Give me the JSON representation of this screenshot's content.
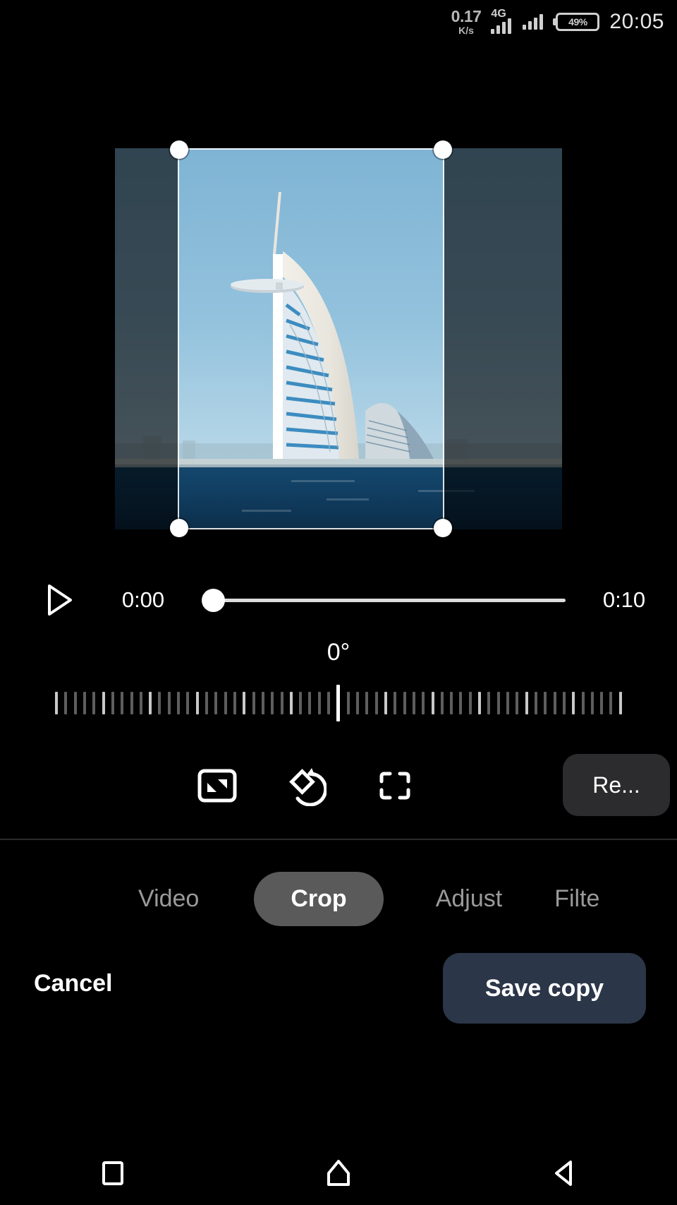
{
  "status_bar": {
    "net_speed_value": "0.17",
    "net_speed_unit": "K/s",
    "network_type": "4G",
    "battery_percent": "49%",
    "clock": "20:05"
  },
  "preview": {
    "image_subject": "Burj Al Arab hotel, Dubai waterfront",
    "crop_overlay": "active"
  },
  "playback": {
    "current_time": "0:00",
    "duration": "0:10",
    "play_icon": "play-icon",
    "progress_percent": 0
  },
  "rotation": {
    "degrees_label": "0°",
    "value": 0
  },
  "tools": [
    {
      "name": "aspect-ratio-icon",
      "label": "Aspect ratio"
    },
    {
      "name": "rotate-icon",
      "label": "Rotate"
    },
    {
      "name": "auto-reframe-icon",
      "label": "Reframe"
    }
  ],
  "reset_button": {
    "label": "Re..."
  },
  "tabs": [
    {
      "label": "Video",
      "selected": false
    },
    {
      "label": "Crop",
      "selected": true
    },
    {
      "label": "Adjust",
      "selected": false
    },
    {
      "label": "Filte",
      "selected": false
    }
  ],
  "actions": {
    "cancel_label": "Cancel",
    "save_label": "Save copy",
    "save_bg": "#2b3649"
  },
  "navbar": [
    {
      "name": "recents-icon"
    },
    {
      "name": "home-icon"
    },
    {
      "name": "back-icon"
    }
  ],
  "colors": {
    "background": "#000000",
    "tab_selected_bg": "#5a5a5a",
    "reset_bg": "#2c2c2e",
    "save_bg": "#2b3649"
  }
}
